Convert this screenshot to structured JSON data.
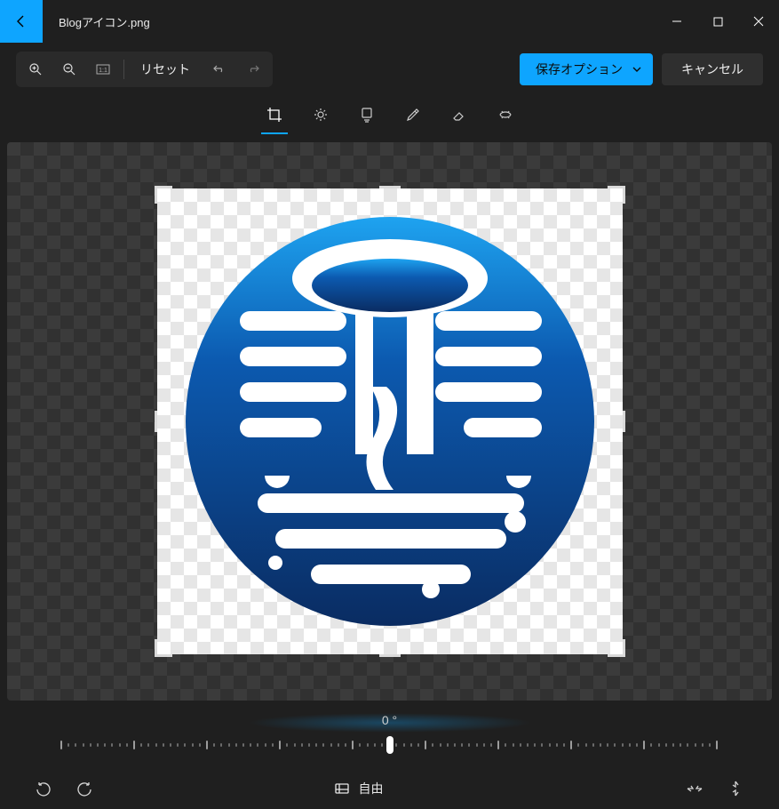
{
  "titlebar": {
    "filename": "Blogアイコン.png"
  },
  "toolbar": {
    "reset_label": "リセット",
    "save_options_label": "保存オプション",
    "cancel_label": "キャンセル"
  },
  "tabs": {
    "active": "crop"
  },
  "rotation": {
    "degrees_display": "0 °"
  },
  "aspect_ratio": {
    "label": "自由"
  }
}
